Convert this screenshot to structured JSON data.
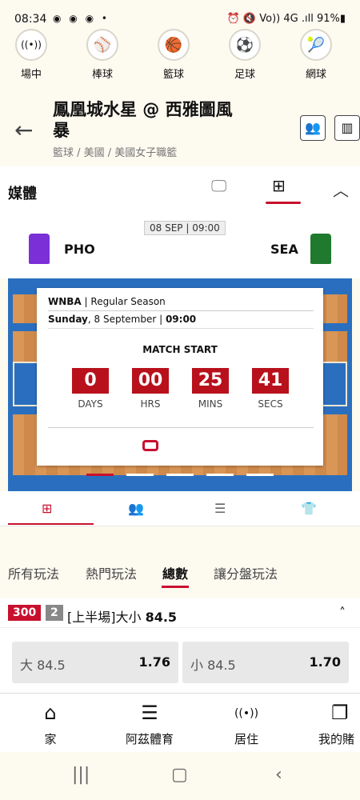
{
  "status": {
    "time": "08:34",
    "left_icons": "◉ ◉ ◉ •",
    "right": "⏰ 🔇 Vo)) 4G .ıll 91%▮"
  },
  "sports": [
    {
      "icon": "((•))",
      "label": "場中"
    },
    {
      "icon": "⚾",
      "label": "棒球"
    },
    {
      "icon": "🏀",
      "label": "籃球"
    },
    {
      "icon": "⚽",
      "label": "足球"
    },
    {
      "icon": "🎾",
      "label": "網球"
    }
  ],
  "header": {
    "title": "鳳凰城水星 @ 西雅圖風暴",
    "breadcrumb": "籃球  /  美國  /  美國女子職籃"
  },
  "media": {
    "title": "媒體"
  },
  "match": {
    "datetime": "08 SEP | 09:00",
    "home": "PHO",
    "away": "SEA"
  },
  "card": {
    "league": "WNBA",
    "season": " | Regular Season",
    "day": "Sunday",
    "date_rest": ", 8 September | ",
    "time": "09:00",
    "start": "MATCH START",
    "countdown": [
      {
        "value": "0",
        "unit": "DAYS"
      },
      {
        "value": "00",
        "unit": "HRS"
      },
      {
        "value": "25",
        "unit": "MINS"
      },
      {
        "value": "41",
        "unit": "SECS"
      }
    ]
  },
  "markets": {
    "tabs": [
      "所有玩法",
      "熱門玩法",
      "總數",
      "讓分盤玩法"
    ],
    "active": "總數"
  },
  "market": {
    "code": "300",
    "count": "2",
    "title_prefix": "[上半場]大小 ",
    "title_value": "84.5",
    "over_label": "大 84.5",
    "over_odds": "1.76",
    "under_label": "小 84.5",
    "under_odds": "1.70"
  },
  "nav": [
    {
      "icon": "⌂",
      "label": "家"
    },
    {
      "icon": "☰",
      "label": "阿茲體育"
    },
    {
      "icon": "((•))",
      "label": "居住"
    },
    {
      "icon": "❐",
      "label": "我的賭"
    }
  ]
}
